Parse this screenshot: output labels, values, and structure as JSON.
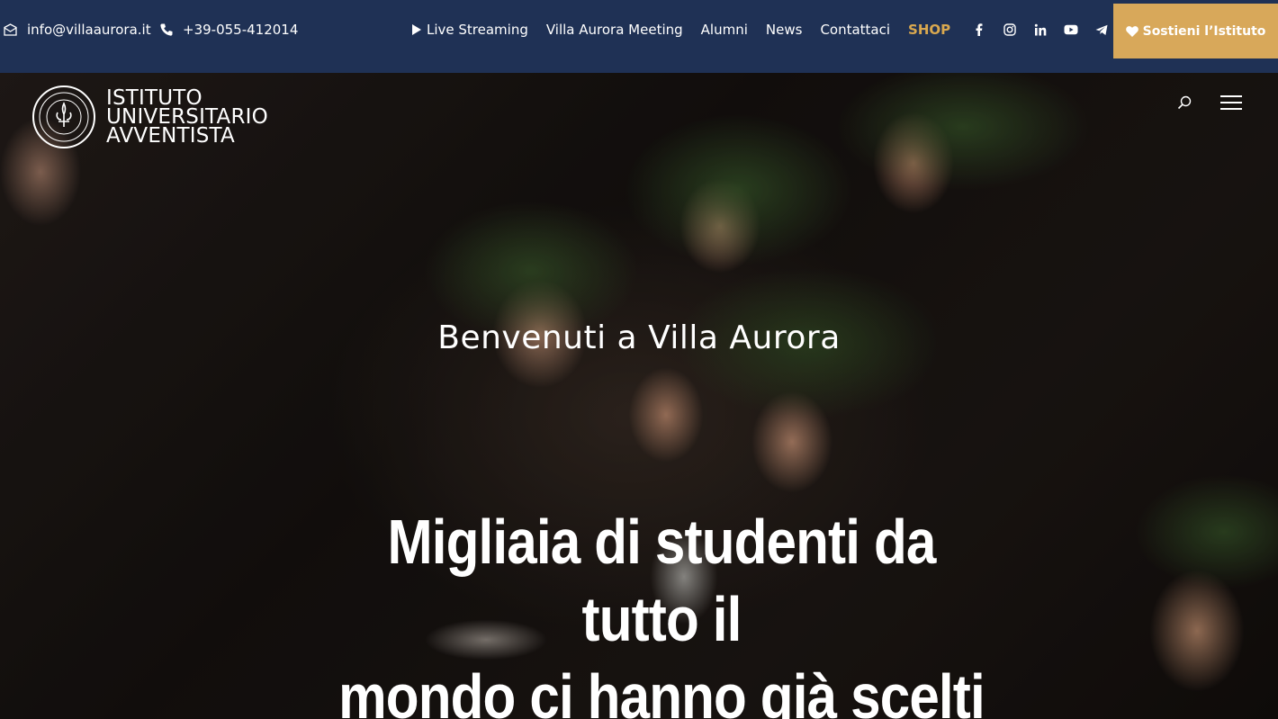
{
  "topbar": {
    "email": "info@villaaurora.it",
    "phone": "+39-055-412014",
    "nav": [
      {
        "label": "Live Streaming",
        "icon": "play-icon"
      },
      {
        "label": "Villa Aurora Meeting"
      },
      {
        "label": "Alumni"
      },
      {
        "label": "News"
      },
      {
        "label": "Contattaci"
      },
      {
        "label": "SHOP"
      }
    ],
    "socials": [
      "facebook-icon",
      "instagram-icon",
      "linkedin-icon",
      "youtube-icon",
      "telegram-icon",
      "italian-flag-icon"
    ],
    "donate_label": "Sostieni l’Istituto"
  },
  "logo": {
    "line1": "ISTITUTO",
    "line2": "UNIVERSITARIO",
    "line3": "AVVENTISTA"
  },
  "hero": {
    "welcome": "Benvenuti a Villa Aurora",
    "headline_line1": "Migliaia di studenti da tutto il",
    "headline_line2": "mondo ci hanno già scelti"
  },
  "colors": {
    "topbar_bg": "#1f3155",
    "accent_gold": "#d8a85a",
    "shop": "#d9a84f"
  }
}
